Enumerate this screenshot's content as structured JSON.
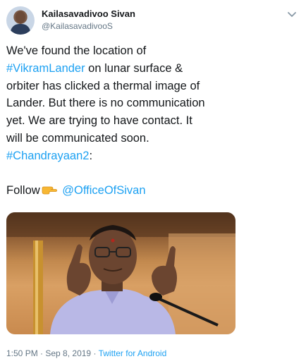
{
  "author": {
    "display_name": "Kailasavadivoo Sivan",
    "handle": "@KailasavadivooS"
  },
  "tweet": {
    "line1": "We've found the location of",
    "line2_link": "#VikramLander",
    "line2_rest": " on lunar surface &",
    "line3": "orbiter has clicked a thermal image of",
    "line4": "Lander. But there is no communication",
    "line5": "yet. We are trying to have contact. It",
    "line6": "will be communicated soon.",
    "line7_link": "#Chandrayaan2",
    "line7_rest": ":",
    "follow_text": "Follow",
    "follow_emoji": "pointing-right-icon",
    "mention": "@OfficeOfSivan"
  },
  "footer": {
    "time": "1:50 PM",
    "sep": " · ",
    "date": "Sep 8, 2019",
    "source": "Twitter for Android"
  },
  "colors": {
    "link": "#1da1f2",
    "muted": "#657786",
    "text": "#14171a"
  }
}
